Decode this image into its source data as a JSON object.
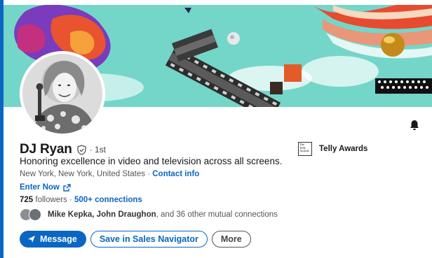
{
  "profile": {
    "name": "DJ Ryan",
    "degree": "· 1st",
    "headline": "Honoring excellence in video and television across all screens.",
    "location": "New York, New York, United States",
    "location_sep": " · ",
    "contact_label": "Contact info",
    "website_label": "Enter Now",
    "followers_count": "725",
    "followers_label": " followers",
    "followers_sep": "  · ",
    "connections_label": "500+ connections",
    "mutual_names": "Mike Kepka, John Draughon",
    "mutual_rest": ", and 36 other mutual connections"
  },
  "company": {
    "logo_lines": [
      "The",
      "Telly",
      "Awards"
    ],
    "name": "Telly Awards"
  },
  "actions": {
    "message_label": "Message",
    "sales_nav_label": "Save in Sales Navigator",
    "more_label": "More"
  },
  "icons": {
    "verify": "shield-check-icon",
    "bell": "bell-icon",
    "external": "external-link-icon",
    "send": "paper-plane-icon"
  },
  "colors": {
    "accent": "#0a66c2",
    "banner_bg": "#6fd3c4"
  }
}
